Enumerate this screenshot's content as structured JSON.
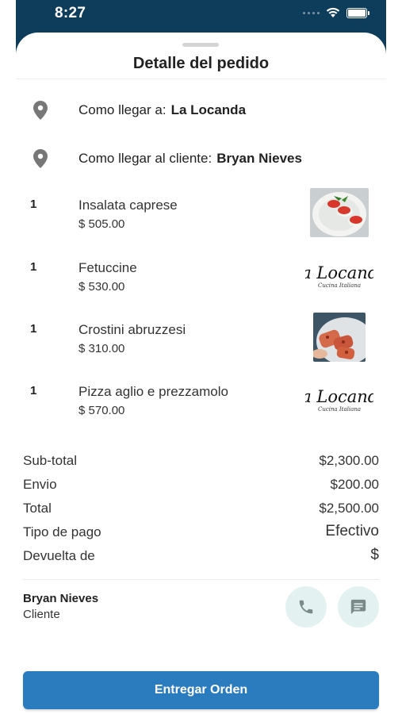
{
  "status_bar": {
    "time": "8:27"
  },
  "sheet": {
    "title": "Detalle del pedido"
  },
  "addresses": [
    {
      "label": "Como llegar a:",
      "name": "La Locanda"
    },
    {
      "label": "Como llegar al cliente:",
      "name": "Bryan Nieves"
    }
  ],
  "items": [
    {
      "qty": "1",
      "name": "Insalata caprese",
      "price": "$ 505.00",
      "image": "photo"
    },
    {
      "qty": "1",
      "name": "Fetuccine",
      "price": "$ 530.00",
      "image": "logo"
    },
    {
      "qty": "1",
      "name": "Crostini abruzzesi",
      "price": "$ 310.00",
      "image": "photo"
    },
    {
      "qty": "1",
      "name": "Pizza aglio e prezzamolo",
      "price": "$ 570.00",
      "image": "logo"
    }
  ],
  "logo": {
    "name": "La Locanda",
    "tagline": "Cucina Italiana"
  },
  "totals": {
    "subtotal_label": "Sub-total",
    "subtotal_value": "$2,300.00",
    "envio_label": "Envio",
    "envio_value": "$200.00",
    "total_label": "Total",
    "total_value": "$2,500.00",
    "pago_label": "Tipo de pago",
    "pago_value": "Efectivo",
    "devuelta_label": "Devuelta de",
    "devuelta_value": "$"
  },
  "client": {
    "name": "Bryan Nieves",
    "role": "Cliente"
  },
  "actions": {
    "deliver_label": "Entregar Orden"
  },
  "icons": {
    "pin": "location-pin-icon",
    "phone": "phone-icon",
    "chat": "chat-icon"
  },
  "colors": {
    "header": "#0e3d5c",
    "primary": "#2a7cbf",
    "circle_button": "#e3f2f0",
    "icon_grey": "#777777"
  }
}
